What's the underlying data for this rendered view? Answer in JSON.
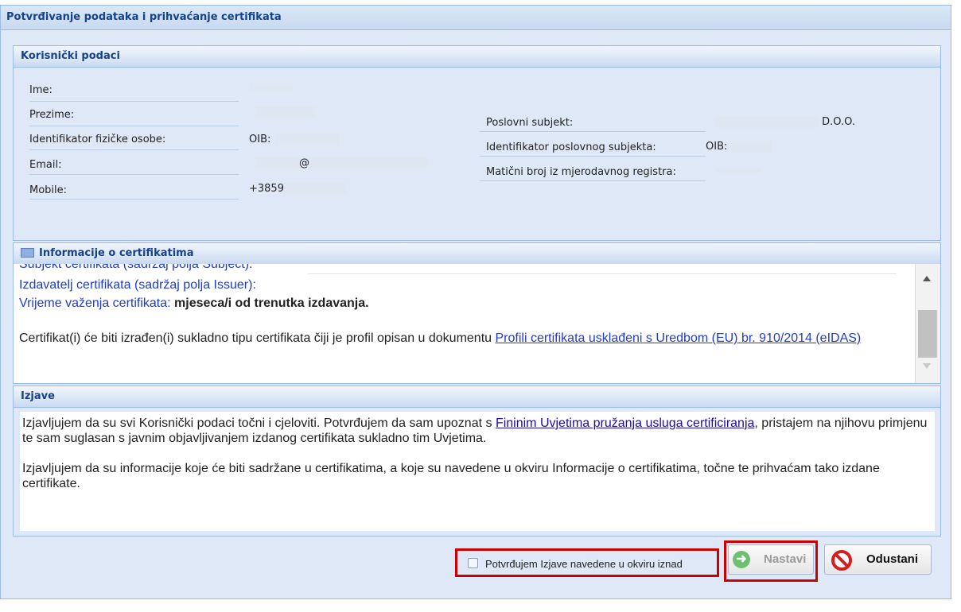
{
  "window": {
    "title": "Potvrđivanje podataka i prihvaćanje certifikata"
  },
  "user_panel": {
    "title": "Korisnički podaci",
    "left": [
      {
        "label": "Ime:",
        "value": ""
      },
      {
        "label": "Prezime:",
        "value": ""
      },
      {
        "label": "Identifikator fizičke osobe:",
        "value": "OIB:"
      },
      {
        "label": "Email:",
        "value": "@"
      },
      {
        "label": "Mobile:",
        "value": "+3859"
      }
    ],
    "right": [
      {
        "label": "Poslovni subjekt:",
        "value": "D.O.O."
      },
      {
        "label": "Identifikator poslovnog subjekta:",
        "value": "OIB:"
      },
      {
        "label": "Matični broj iz mjerodavnog registra:",
        "value": ""
      }
    ]
  },
  "info_panel": {
    "title": "Informacije o certifikatima",
    "subject_label": "Subjekt certifikata (sadržaj polja Subject):",
    "issuer_label": "Izdavatelj certifikata (sadržaj polja Issuer):",
    "validity_label": "Vrijeme važenja certifikata:",
    "validity_value": "mjeseca/i od trenutka izdavanja.",
    "profile_text": "Certifikat(i) će biti izrađen(i) sukladno tipu certifikata čiji je profil opisan u dokumentu",
    "profile_link": "Profili certifikata usklađeni s Uredbom (EU) br. 910/2014 (eIDAS)"
  },
  "izjave_panel": {
    "title": "Izjave",
    "p1_before": "Izjavljujem da su svi Korisnički podaci točni i cjeloviti. Potvrđujem da sam upoznat s",
    "p1_link": "Fininim Uvjetima pružanja usluga certificiranja",
    "p1_after": ", pristajem na njihovu primjenu te sam suglasan s javnim objavljivanjem izdanog certifikata sukladno tim Uvjetima.",
    "p2": "Izjavljujem da su informacije koje će biti sadržane u certifikatima, a koje su navedene u okviru Informacije o certifikatima, točne te prihvaćam tako izdane certifikate."
  },
  "footer": {
    "confirm_label": "Potvrđujem Izjave navedene u okviru iznad",
    "confirm_checked": false,
    "next_label": "Nastavi",
    "cancel_label": "Odustani"
  },
  "colors": {
    "header_text": "#15428b",
    "panel_bg": "#dfe8f6",
    "link": "#1f3ccc",
    "highlight": "#cc0000"
  },
  "icons": {
    "info_header": "card-icon",
    "next": "arrow-right-icon",
    "cancel": "stop-icon"
  }
}
